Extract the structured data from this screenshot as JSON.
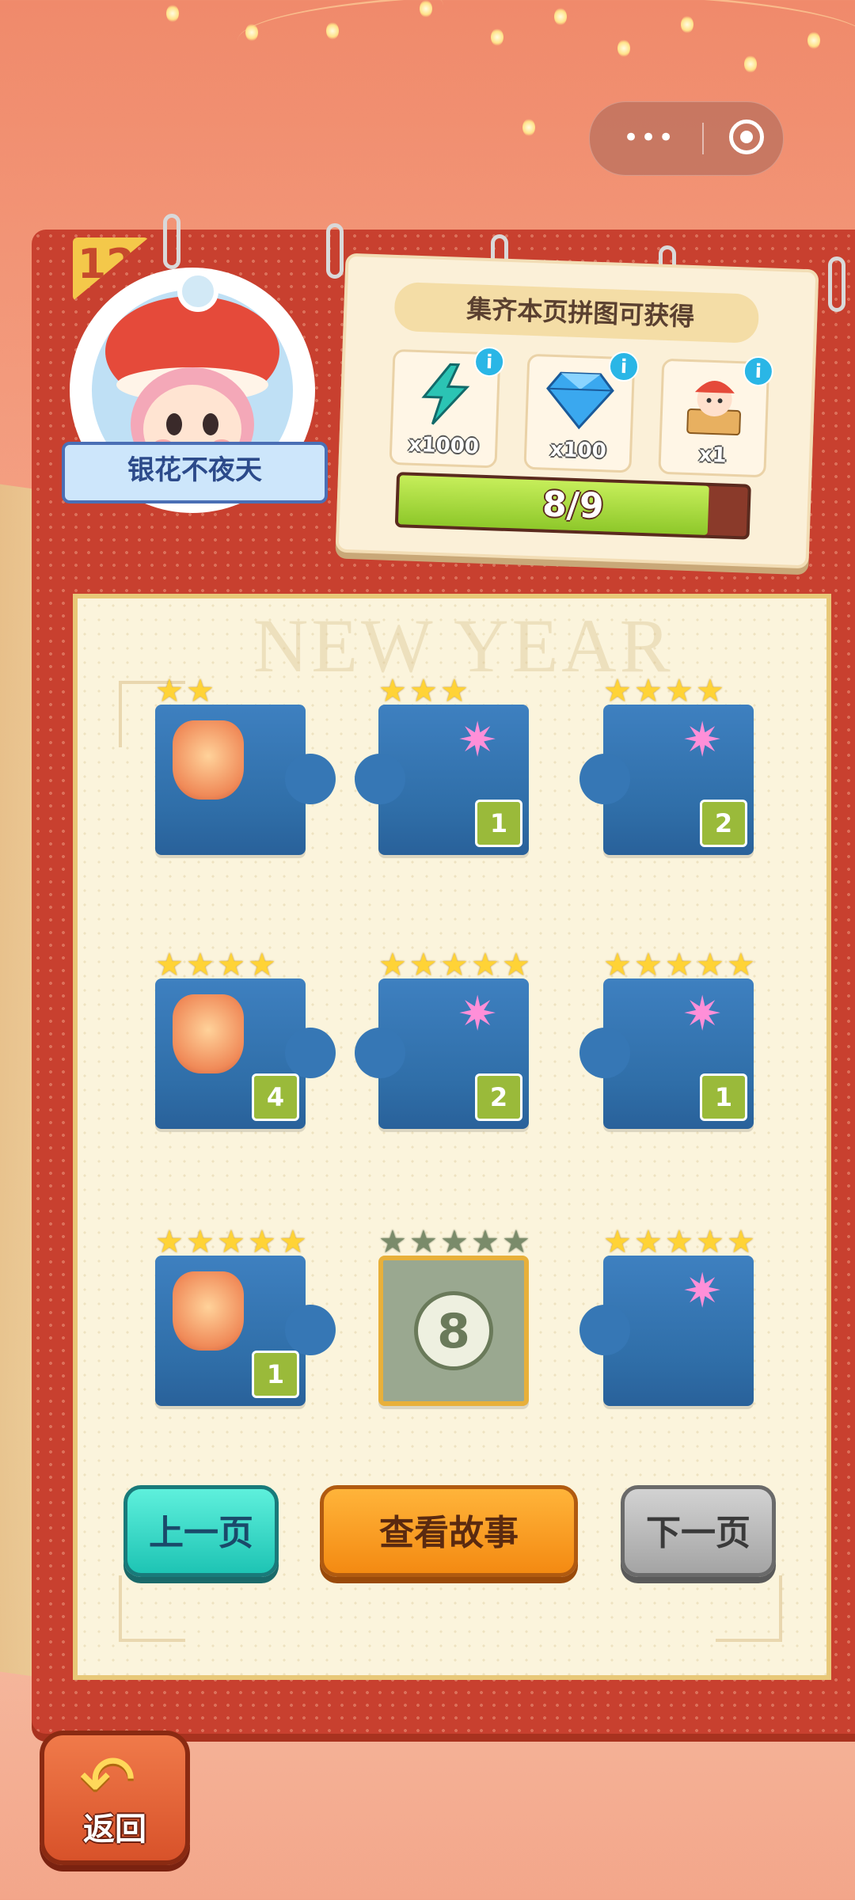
{
  "top_bar": {
    "menu_icon": "more-dots-icon",
    "close_icon": "target-close-icon"
  },
  "badge": {
    "page_number": "12",
    "title": "银花不夜天"
  },
  "rewards": {
    "title": "集齐本页拼图可获得",
    "items": [
      {
        "icon": "lightning-energy-icon",
        "quantity": "x1000",
        "color": "#2bc4b4"
      },
      {
        "icon": "blue-diamond-icon",
        "quantity": "x100",
        "color": "#3aa8ef"
      },
      {
        "icon": "jester-doll-icon",
        "quantity": "x1",
        "color": "#e54a3a"
      }
    ],
    "progress": {
      "text": "8/9",
      "collected": 8,
      "total": 9
    }
  },
  "puzzle": {
    "watermark": "NEW YEAR",
    "pieces": [
      {
        "stars": 2,
        "count": ""
      },
      {
        "stars": 3,
        "count": "1"
      },
      {
        "stars": 4,
        "count": "2"
      },
      {
        "stars": 4,
        "count": "4"
      },
      {
        "stars": 5,
        "count": "2"
      },
      {
        "stars": 5,
        "count": "1"
      },
      {
        "stars": 5,
        "count": "1"
      },
      {
        "stars": 5,
        "count": "",
        "locked": true,
        "number": "8"
      },
      {
        "stars": 5,
        "count": ""
      }
    ]
  },
  "buttons": {
    "prev": "上一页",
    "story": "查看故事",
    "next": "下一页"
  },
  "back": {
    "label": "返回",
    "icon": "back-arrow-icon"
  },
  "colors": {
    "accent_red": "#c8402f",
    "page_cream": "#fbf4dc",
    "piece_blue": "#2f6ea8",
    "star_gold": "#ffd336"
  }
}
